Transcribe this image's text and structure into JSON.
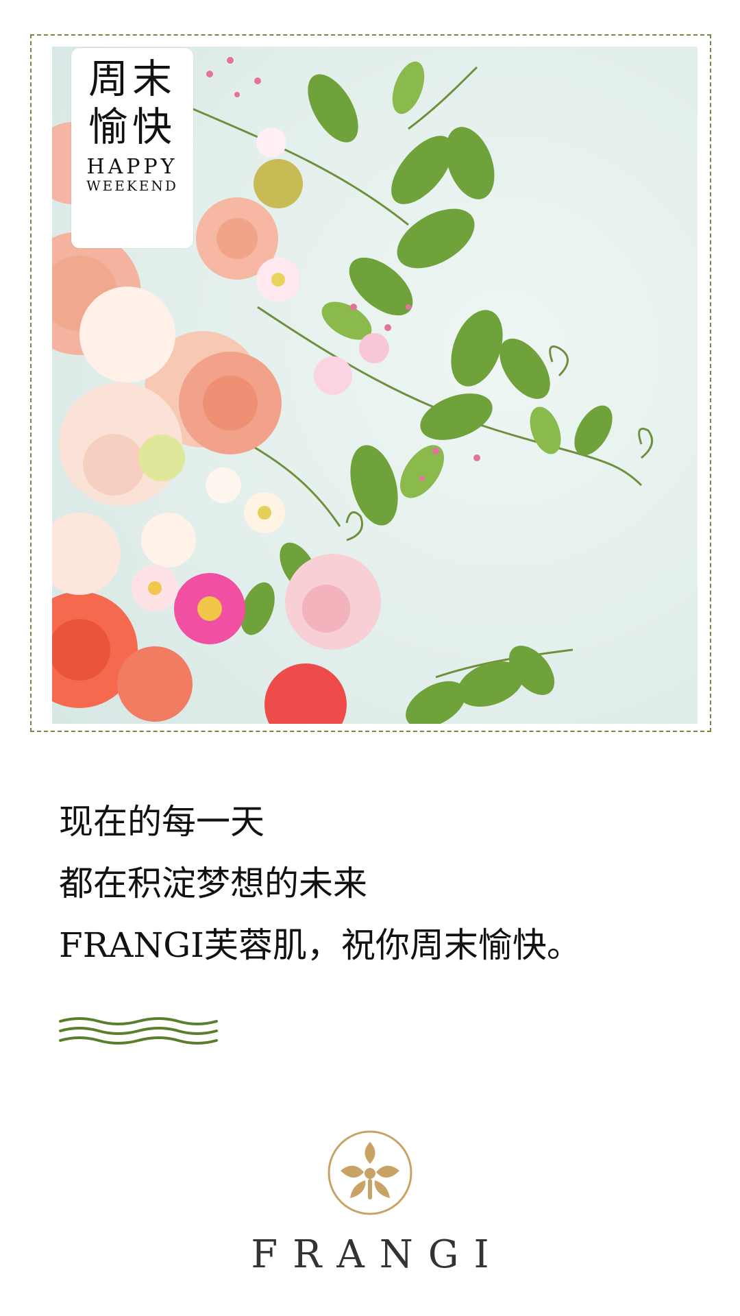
{
  "badge": {
    "title_cn": "周末\n愉快",
    "title_en_line1": "HAPPY",
    "title_en_line2": "WEEKEND"
  },
  "message": {
    "lines": [
      "现在的每一天",
      "都在积淀梦想的未来",
      "FRANGI芙蓉肌，祝你周末愉快。"
    ]
  },
  "brand": {
    "name": "FRANGI",
    "gold": "#c8a365",
    "text_color": "#333333"
  },
  "colors": {
    "frame": "#6d8a3e",
    "wave": "#5a7f2c",
    "photo_bg": "#e3efec"
  },
  "icons": {
    "logo": "frangi-emblem-icon",
    "decor": "wave-lines-icon"
  }
}
